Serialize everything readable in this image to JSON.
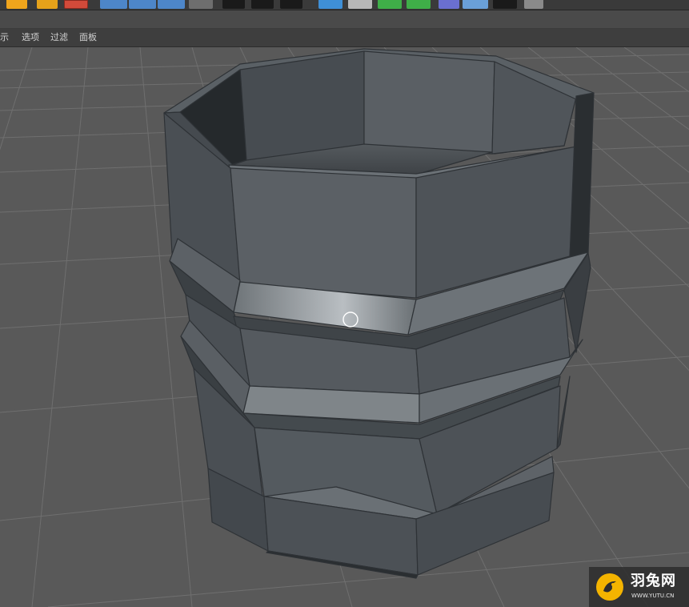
{
  "toolbar": {
    "buttons": [
      {
        "name": "render-region-icon",
        "color": "#f0a51c"
      },
      {
        "name": "render-settings-icon",
        "color": "#e6a21a"
      },
      {
        "name": "render-stop-icon",
        "color": "#d24a3a"
      },
      {
        "name": "move-tool-icon",
        "color": "#4d86c9"
      },
      {
        "name": "scale-tool-icon",
        "color": "#4d86c9"
      },
      {
        "name": "rotate-tool-icon",
        "color": "#4d86c9"
      },
      {
        "name": "coordinate-system-icon",
        "color": "#7a7a7a"
      },
      {
        "name": "render-view-icon",
        "color": "#1a1a1a"
      },
      {
        "name": "render-picture-viewer-icon",
        "color": "#1a1a1a"
      },
      {
        "name": "edit-render-settings-icon",
        "color": "#1a1a1a"
      },
      {
        "name": "cube-primitive-icon",
        "color": "#3f8fd6"
      },
      {
        "name": "spline-pen-icon",
        "color": "#d8d8d8"
      },
      {
        "name": "subdivision-icon",
        "color": "#3fae48"
      },
      {
        "name": "array-icon",
        "color": "#3fae48"
      },
      {
        "name": "deformer-icon",
        "color": "#6a6fd0"
      },
      {
        "name": "floor-icon",
        "color": "#6aa0d8"
      },
      {
        "name": "camera-icon",
        "color": "#1a1a1a"
      },
      {
        "name": "light-icon",
        "color": "#d0d0d0"
      }
    ]
  },
  "menubar": {
    "items": [
      {
        "id": "display",
        "label": "显示"
      },
      {
        "id": "options",
        "label": "选项"
      },
      {
        "id": "filter",
        "label": "过滤"
      },
      {
        "id": "panel",
        "label": "面板"
      }
    ]
  },
  "viewport": {
    "background_color": "#595959",
    "grid_color": "#707070",
    "object": "octagonal-cup-model",
    "object_color": "#4f5458"
  },
  "watermark": {
    "title": "羽兔网",
    "url": "WWW.YUTU.CN",
    "logo_color": "#f4b400"
  }
}
